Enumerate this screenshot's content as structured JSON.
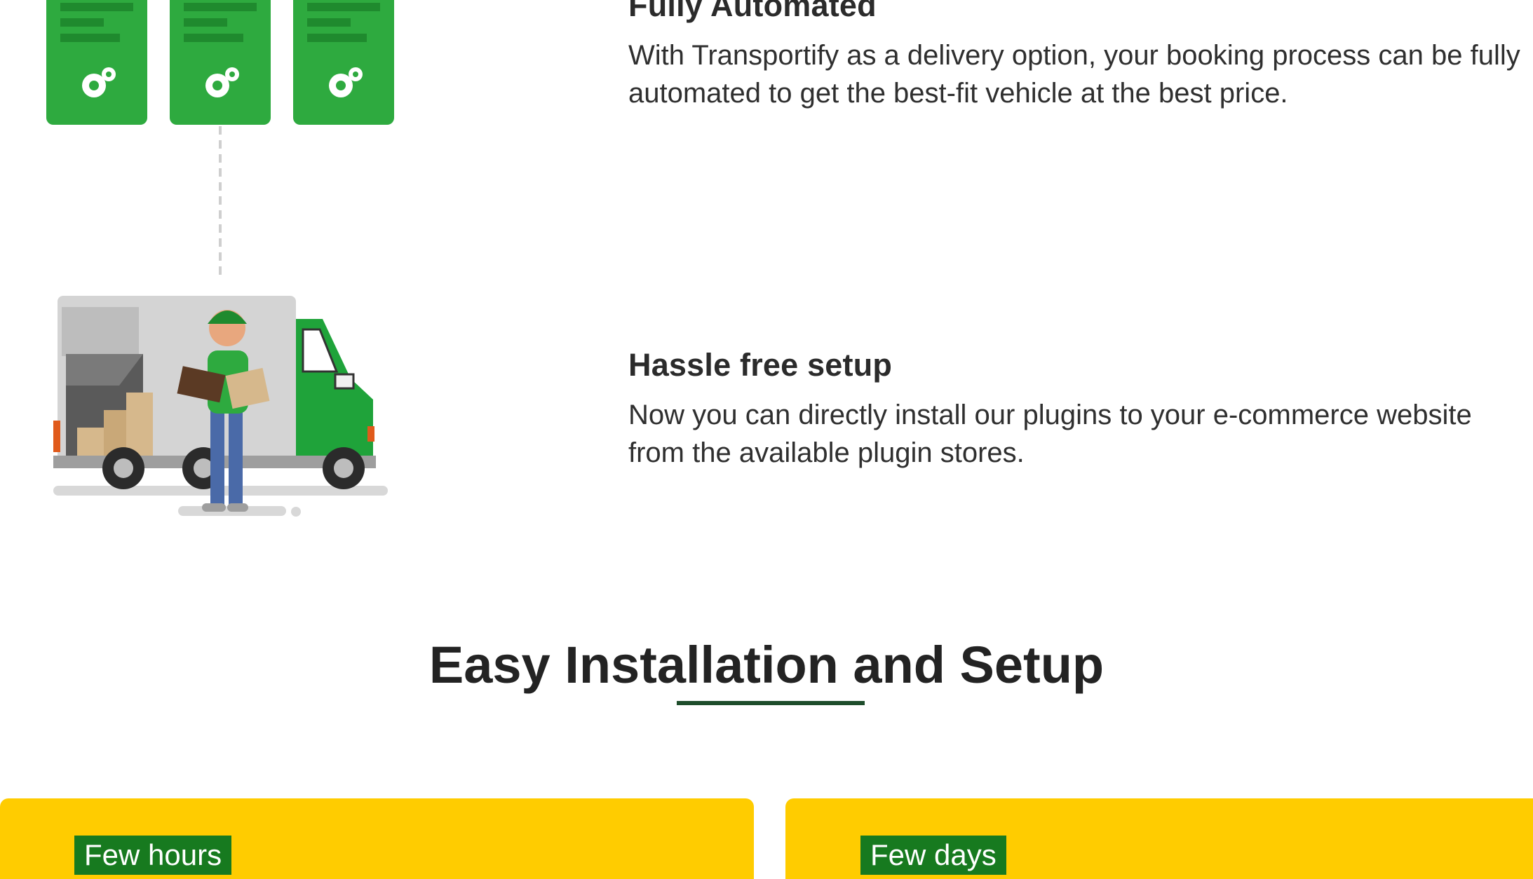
{
  "features": [
    {
      "title": "Fully Automated",
      "description": "With Transportify as a delivery option, your booking process can be fully automated to get the best-fit vehicle at the best price."
    },
    {
      "title": "Hassle free setup",
      "description": "Now you can directly install our plugins to your e-commerce website from the available plugin stores."
    }
  ],
  "section": {
    "title": "Easy Installation and Setup"
  },
  "cards": [
    {
      "tag": "Few hours"
    },
    {
      "tag": "Few days"
    }
  ],
  "colors": {
    "brand_green": "#2eaa3f",
    "dark_green": "#177a1f",
    "underline": "#1e4d2b",
    "card_yellow": "#ffcc00"
  }
}
